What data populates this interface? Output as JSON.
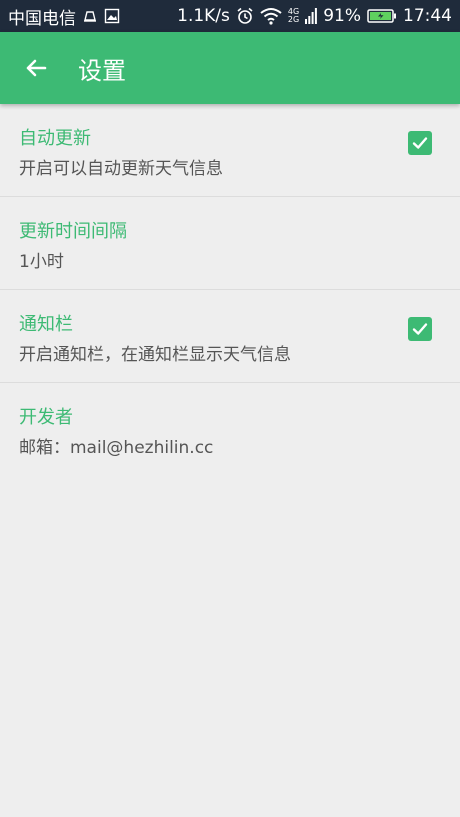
{
  "status_bar": {
    "carrier": "中国电信",
    "speed": "1.1K/s",
    "network_4g": "4G",
    "network_2g": "2G",
    "battery": "91%",
    "time": "17:44",
    "icons": [
      "notification-icon",
      "gallery-icon",
      "alarm-icon",
      "wifi-icon",
      "signal-icon",
      "battery-icon"
    ]
  },
  "toolbar": {
    "title": "设置",
    "back_icon": "arrow-left-icon"
  },
  "colors": {
    "accent": "#3dba74",
    "status_bar": "#1f2b3b",
    "background": "#eeeeee"
  },
  "preferences": [
    {
      "title": "自动更新",
      "summary": "开启可以自动更新天气信息",
      "checkbox": true,
      "checked": true
    },
    {
      "title": "更新时间间隔",
      "summary": "1小时",
      "checkbox": false
    },
    {
      "title": "通知栏",
      "summary": "开启通知栏，在通知栏显示天气信息",
      "checkbox": true,
      "checked": true
    },
    {
      "title": "开发者",
      "summary": "邮箱：mail@hezhilin.cc",
      "checkbox": false
    }
  ]
}
